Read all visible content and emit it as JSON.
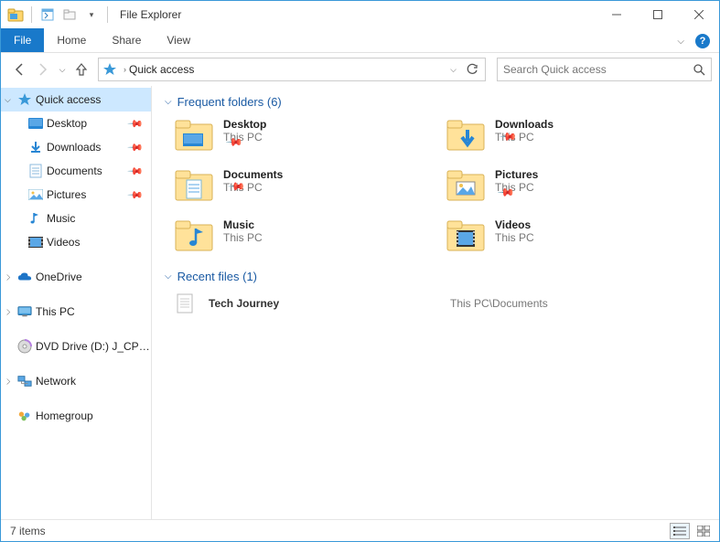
{
  "window": {
    "title": "File Explorer"
  },
  "ribbon": {
    "file": "File",
    "tabs": [
      "Home",
      "Share",
      "View"
    ]
  },
  "address": {
    "location": "Quick access"
  },
  "search": {
    "placeholder": "Search Quick access"
  },
  "nav": {
    "quickaccess": {
      "label": "Quick access",
      "pinned": [
        {
          "label": "Desktop",
          "icon": "desktop"
        },
        {
          "label": "Downloads",
          "icon": "downloads"
        },
        {
          "label": "Documents",
          "icon": "documents"
        },
        {
          "label": "Pictures",
          "icon": "pictures"
        }
      ],
      "unpinned": [
        {
          "label": "Music",
          "icon": "music"
        },
        {
          "label": "Videos",
          "icon": "videos"
        }
      ]
    },
    "onedrive": "OneDrive",
    "thispc": "This PC",
    "dvd": "DVD Drive (D:) J_CPRA",
    "network": "Network",
    "homegroup": "Homegroup"
  },
  "content": {
    "frequent": {
      "title": "Frequent folders (6)",
      "items": [
        {
          "name": "Desktop",
          "loc": "This PC",
          "icon": "desktop",
          "pinned": true
        },
        {
          "name": "Downloads",
          "loc": "This PC",
          "icon": "downloads",
          "pinned": true
        },
        {
          "name": "Documents",
          "loc": "This PC",
          "icon": "documents",
          "pinned": true
        },
        {
          "name": "Pictures",
          "loc": "This PC",
          "icon": "pictures",
          "pinned": true
        },
        {
          "name": "Music",
          "loc": "This PC",
          "icon": "music",
          "pinned": false
        },
        {
          "name": "Videos",
          "loc": "This PC",
          "icon": "videos",
          "pinned": false
        }
      ]
    },
    "recent": {
      "title": "Recent files (1)",
      "items": [
        {
          "name": "Tech Journey",
          "path": "This PC\\Documents"
        }
      ]
    }
  },
  "statusbar": {
    "count_text": "7 items"
  }
}
